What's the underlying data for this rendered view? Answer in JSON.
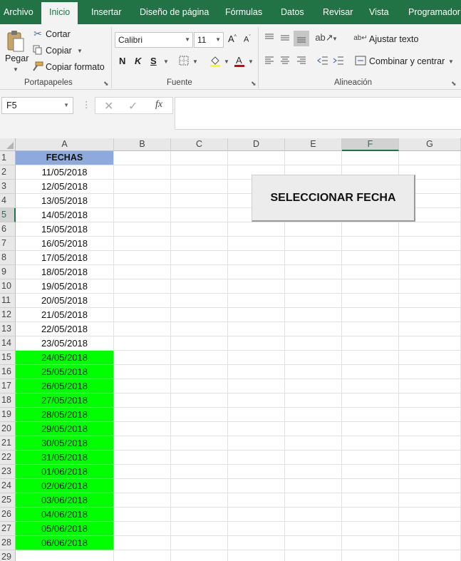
{
  "tabs": [
    {
      "label": "Archivo",
      "active": false
    },
    {
      "label": "Inicio",
      "active": true
    },
    {
      "label": "Insertar",
      "active": false
    },
    {
      "label": "Diseño de página",
      "active": false
    },
    {
      "label": "Fórmulas",
      "active": false
    },
    {
      "label": "Datos",
      "active": false
    },
    {
      "label": "Revisar",
      "active": false
    },
    {
      "label": "Vista",
      "active": false
    },
    {
      "label": "Programador",
      "active": false
    }
  ],
  "clipboard": {
    "paste_label": "Pegar",
    "cut_label": "Cortar",
    "copy_label": "Copiar",
    "format_painter_label": "Copiar formato",
    "group_label": "Portapapeles"
  },
  "font": {
    "font_name": "Calibri",
    "font_size": "11",
    "bold": "N",
    "italic": "K",
    "underline": "S",
    "group_label": "Fuente"
  },
  "alignment": {
    "wrap_text_label": "Ajustar texto",
    "merge_center_label": "Combinar y centrar",
    "group_label": "Alineación"
  },
  "formula_bar": {
    "name_box": "F5",
    "fx": "fx",
    "formula": ""
  },
  "columns": [
    "A",
    "B",
    "C",
    "D",
    "E",
    "F",
    "G"
  ],
  "selected_column": "F",
  "selected_row": 5,
  "column_a_header": "FECHAS",
  "dates": [
    {
      "row": 2,
      "value": "11/05/2018",
      "highlight": false
    },
    {
      "row": 3,
      "value": "12/05/2018",
      "highlight": false
    },
    {
      "row": 4,
      "value": "13/05/2018",
      "highlight": false
    },
    {
      "row": 5,
      "value": "14/05/2018",
      "highlight": false
    },
    {
      "row": 6,
      "value": "15/05/2018",
      "highlight": false
    },
    {
      "row": 7,
      "value": "16/05/2018",
      "highlight": false
    },
    {
      "row": 8,
      "value": "17/05/2018",
      "highlight": false
    },
    {
      "row": 9,
      "value": "18/05/2018",
      "highlight": false
    },
    {
      "row": 10,
      "value": "19/05/2018",
      "highlight": false
    },
    {
      "row": 11,
      "value": "20/05/2018",
      "highlight": false
    },
    {
      "row": 12,
      "value": "21/05/2018",
      "highlight": false
    },
    {
      "row": 13,
      "value": "22/05/2018",
      "highlight": false
    },
    {
      "row": 14,
      "value": "23/05/2018",
      "highlight": false
    },
    {
      "row": 15,
      "value": "24/05/2018",
      "highlight": true
    },
    {
      "row": 16,
      "value": "25/05/2018",
      "highlight": true
    },
    {
      "row": 17,
      "value": "26/05/2018",
      "highlight": true
    },
    {
      "row": 18,
      "value": "27/05/2018",
      "highlight": true
    },
    {
      "row": 19,
      "value": "28/05/2018",
      "highlight": true
    },
    {
      "row": 20,
      "value": "29/05/2018",
      "highlight": true
    },
    {
      "row": 21,
      "value": "30/05/2018",
      "highlight": true
    },
    {
      "row": 22,
      "value": "31/05/2018",
      "highlight": true
    },
    {
      "row": 23,
      "value": "01/06/2018",
      "highlight": true
    },
    {
      "row": 24,
      "value": "02/06/2018",
      "highlight": true
    },
    {
      "row": 25,
      "value": "03/06/2018",
      "highlight": true
    },
    {
      "row": 26,
      "value": "04/06/2018",
      "highlight": true
    },
    {
      "row": 27,
      "value": "05/06/2018",
      "highlight": true
    },
    {
      "row": 28,
      "value": "06/06/2018",
      "highlight": true
    }
  ],
  "last_row": 29,
  "button_label": "SELECCIONAR FECHA",
  "colors": {
    "ribbon_green": "#217346",
    "header_blue": "#8ea9db",
    "highlight_green": "#00ff00"
  }
}
